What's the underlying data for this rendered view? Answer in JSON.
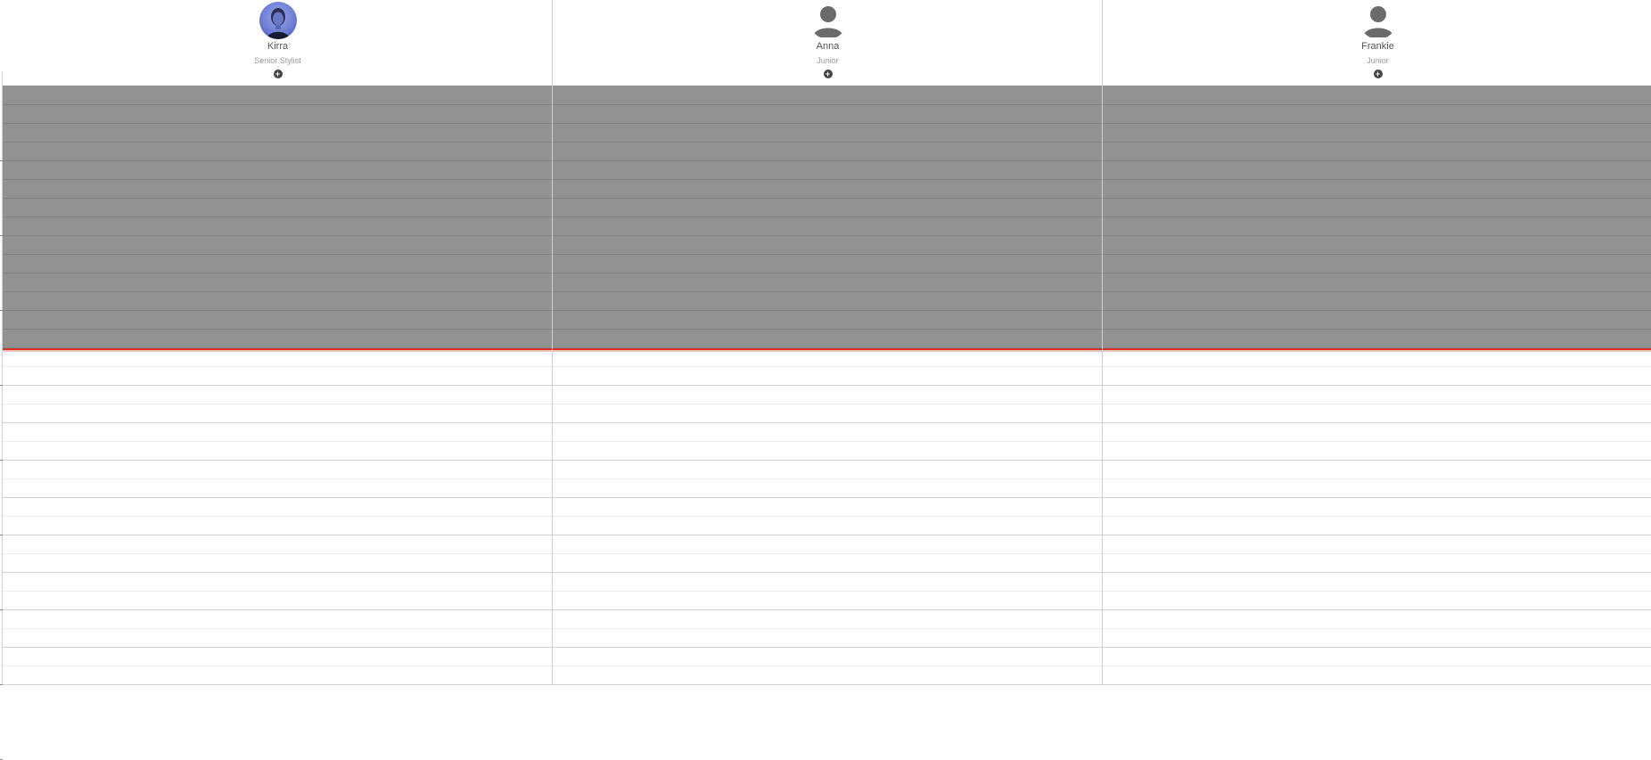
{
  "staff": [
    {
      "name": "Kirra",
      "role": "Senior Stylist",
      "avatar": "photo",
      "add_icon": "plus-circle-icon"
    },
    {
      "name": "Anna",
      "role": "Junior",
      "avatar": "person-placeholder-icon",
      "add_icon": "plus-circle-icon"
    },
    {
      "name": "Frankie",
      "role": "Junior",
      "avatar": "person-placeholder-icon",
      "add_icon": "plus-circle-icon"
    }
  ],
  "colors": {
    "blocked": "#929292",
    "now_line": "#d9312a",
    "grid_major": "#d2d2d2",
    "grid_minor": "#ececec",
    "placeholder_icon": "#6b6b6b"
  },
  "add_symbol": "+"
}
